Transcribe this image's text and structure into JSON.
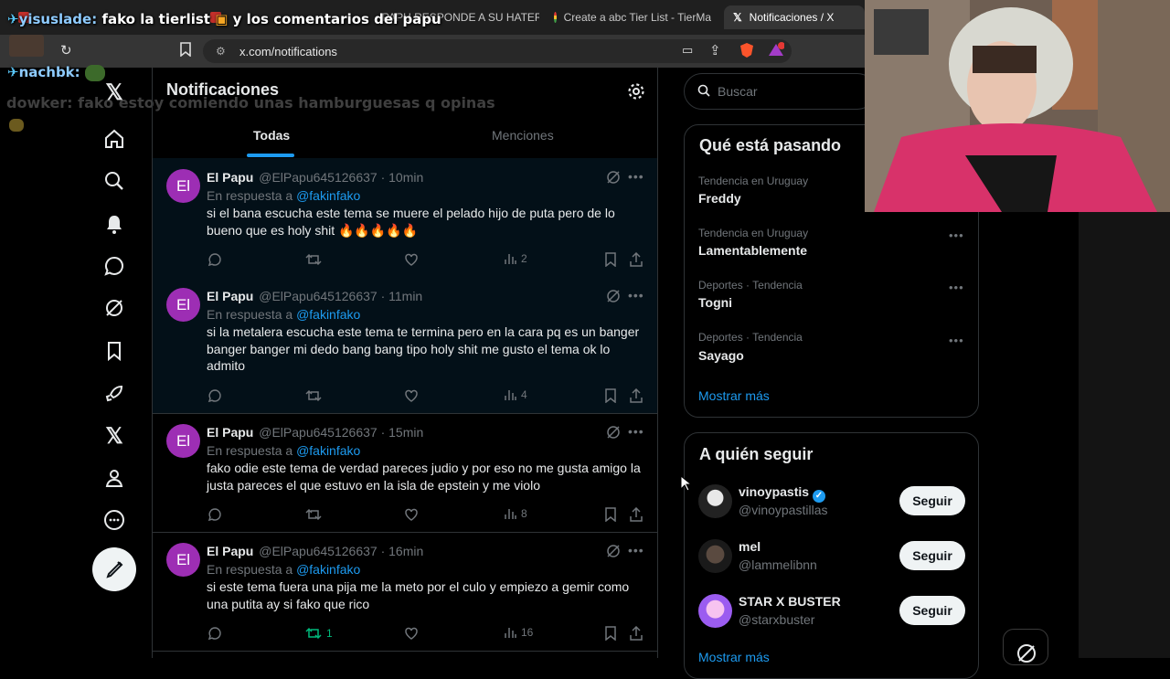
{
  "browser": {
    "tabs": [
      {
        "label": "...",
        "color": "#c4302b"
      },
      {
        "label": "...",
        "color": "#c4302b"
      },
      {
        "label": "PAPU RESPONDE A SU HATER",
        "color": "#ff0000"
      },
      {
        "label": "Create a abc Tier List - TierMa",
        "color": "#1a73e8"
      },
      {
        "label": "Notificaciones / X",
        "color": "#ffffff"
      }
    ],
    "url": "x.com/notifications"
  },
  "chat": [
    {
      "user": "yisuslade:",
      "text": "fako la tierlist",
      "text2": "y los comentarios del papu",
      "user_color": "#8ecbff"
    },
    {
      "user": "nachbk:",
      "text": "",
      "text2": "",
      "user_color": "#8ecbff"
    },
    {
      "user": "dowker:",
      "text": "fako estoy comiendo unas hamburguesas q opinas",
      "text2": "",
      "user_color": "#3c3c3c"
    }
  ],
  "nav": {
    "icons": [
      "x-logo-icon",
      "home-icon",
      "search-icon",
      "bell-icon",
      "message-icon",
      "grok-icon",
      "bookmark-icon",
      "rocket-icon",
      "x-premium-icon",
      "profile-icon",
      "more-icon",
      "compose-icon"
    ]
  },
  "feed": {
    "title": "Notificaciones",
    "tabs": [
      "Todas",
      "Menciones"
    ],
    "notifications": [
      {
        "avatar": "El",
        "name": "El Papu",
        "handle": "@ElPapu645126637 · 10min",
        "reply_prefix": "En respuesta a",
        "mention": "@fakinfako",
        "text": "si el bana escucha este tema se muere el pelado hijo de puta pero de lo bueno que es holy shit 🔥🔥🔥🔥🔥",
        "views": "2",
        "reposts": "",
        "unread": true
      },
      {
        "avatar": "El",
        "name": "El Papu",
        "handle": "@ElPapu645126637 · 11min",
        "reply_prefix": "En respuesta a",
        "mention": "@fakinfako",
        "text": "si la metalera escucha este tema te termina pero en la cara pq es un banger banger banger mi dedo bang bang tipo holy shit me gusto el tema ok lo admito",
        "views": "4",
        "reposts": "",
        "unread": true
      },
      {
        "avatar": "El",
        "name": "El Papu",
        "handle": "@ElPapu645126637 · 15min",
        "reply_prefix": "En respuesta a",
        "mention": "@fakinfako",
        "text": "fako odie este tema de verdad pareces judio y por eso no me gusta amigo la justa pareces el que estuvo en la isla de epstein y me violo",
        "views": "8",
        "reposts": "",
        "unread": false
      },
      {
        "avatar": "El",
        "name": "El Papu",
        "handle": "@ElPapu645126637 · 16min",
        "reply_prefix": "En respuesta a",
        "mention": "@fakinfako",
        "text": "si este tema fuera una pija me la meto por el culo y empiezo a gemir como una putita ay si fako que rico",
        "views": "16",
        "reposts": "1",
        "unread": false
      }
    ]
  },
  "sidebar": {
    "search_placeholder": "Buscar",
    "trends_title": "Qué está pasando",
    "trends": [
      {
        "meta": "Tendencia en Uruguay",
        "name": "Freddy"
      },
      {
        "meta": "Tendencia en Uruguay",
        "name": "Lamentablemente"
      },
      {
        "meta": "Deportes · Tendencia",
        "name": "Togni"
      },
      {
        "meta": "Deportes · Tendencia",
        "name": "Sayago"
      }
    ],
    "show_more": "Mostrar más",
    "follow_title": "A quién seguir",
    "follow": [
      {
        "name": "vinoypastis",
        "handle": "@vinoypastillas",
        "verified": true,
        "button": "Seguir"
      },
      {
        "name": "mel",
        "handle": "@lammelibnn",
        "verified": false,
        "button": "Seguir"
      },
      {
        "name": "STAR X BUSTER",
        "handle": "@starxbuster",
        "verified": false,
        "button": "Seguir"
      }
    ],
    "follow_more": "Mostrar más"
  },
  "colors": {
    "accent": "#1d9bf0",
    "avatar": "#9d2eb4",
    "repost_green": "#00ba7c"
  }
}
